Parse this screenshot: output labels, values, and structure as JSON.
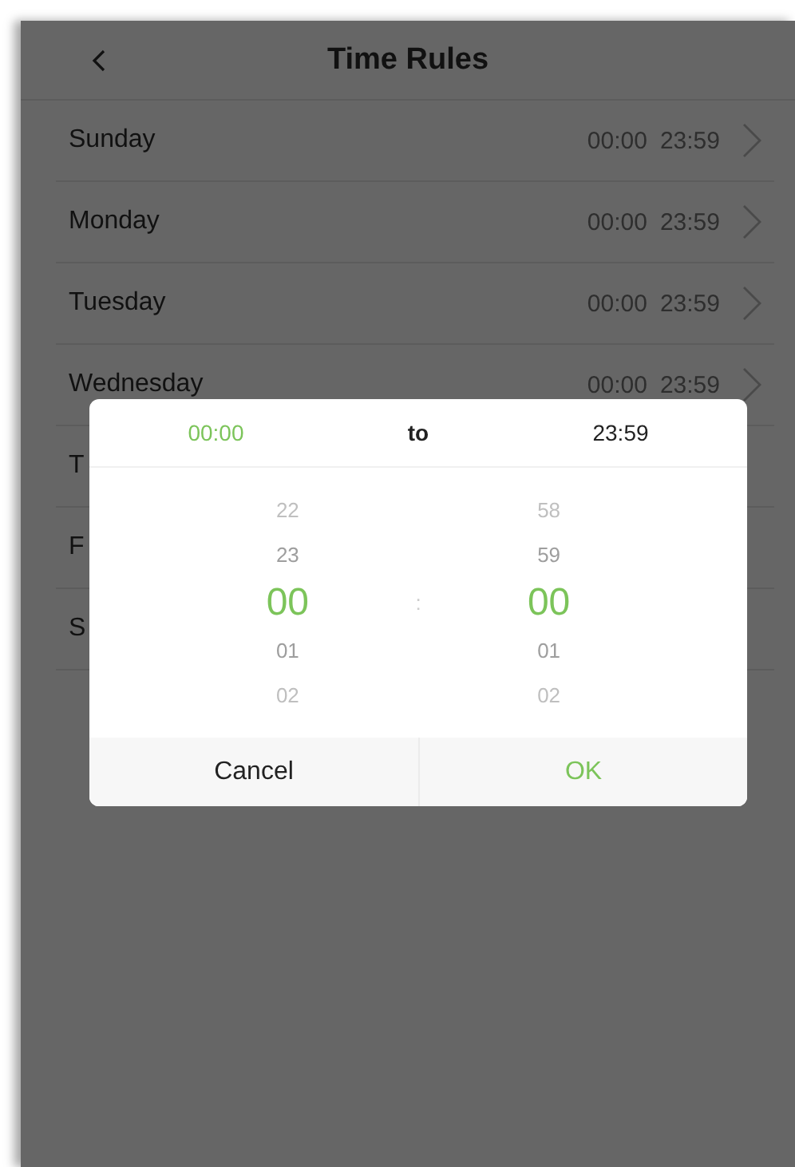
{
  "header": {
    "title": "Time Rules"
  },
  "rows": [
    {
      "day": "Sunday",
      "start": "00:00",
      "end": "23:59"
    },
    {
      "day": "Monday",
      "start": "00:00",
      "end": "23:59"
    },
    {
      "day": "Tuesday",
      "start": "00:00",
      "end": "23:59"
    },
    {
      "day": "Wednesday",
      "start": "00:00",
      "end": "23:59"
    },
    {
      "day": "T"
    },
    {
      "day": "F"
    },
    {
      "day": "S"
    }
  ],
  "dialog": {
    "range": [
      {
        "kind": "time",
        "label": "00:00",
        "selected": true
      },
      {
        "kind": "separator",
        "label": "to"
      },
      {
        "kind": "time",
        "label": "23:59",
        "selected": false
      }
    ],
    "columns": [
      {
        "items": [
          {
            "label": "22",
            "selected": false
          },
          {
            "label": "23",
            "selected": false
          },
          {
            "label": "00",
            "selected": true
          },
          {
            "label": "01",
            "selected": false
          },
          {
            "label": "02",
            "selected": false
          }
        ]
      },
      {
        "items": [
          {
            "label": "58",
            "selected": false
          },
          {
            "label": "59",
            "selected": false
          },
          {
            "label": "00",
            "selected": true
          },
          {
            "label": "01",
            "selected": false
          },
          {
            "label": "02",
            "selected": false
          }
        ]
      }
    ],
    "divider": ":",
    "buttons": [
      {
        "label": "Cancel",
        "kind": "cancel"
      },
      {
        "label": "OK",
        "kind": "confirm"
      }
    ]
  }
}
